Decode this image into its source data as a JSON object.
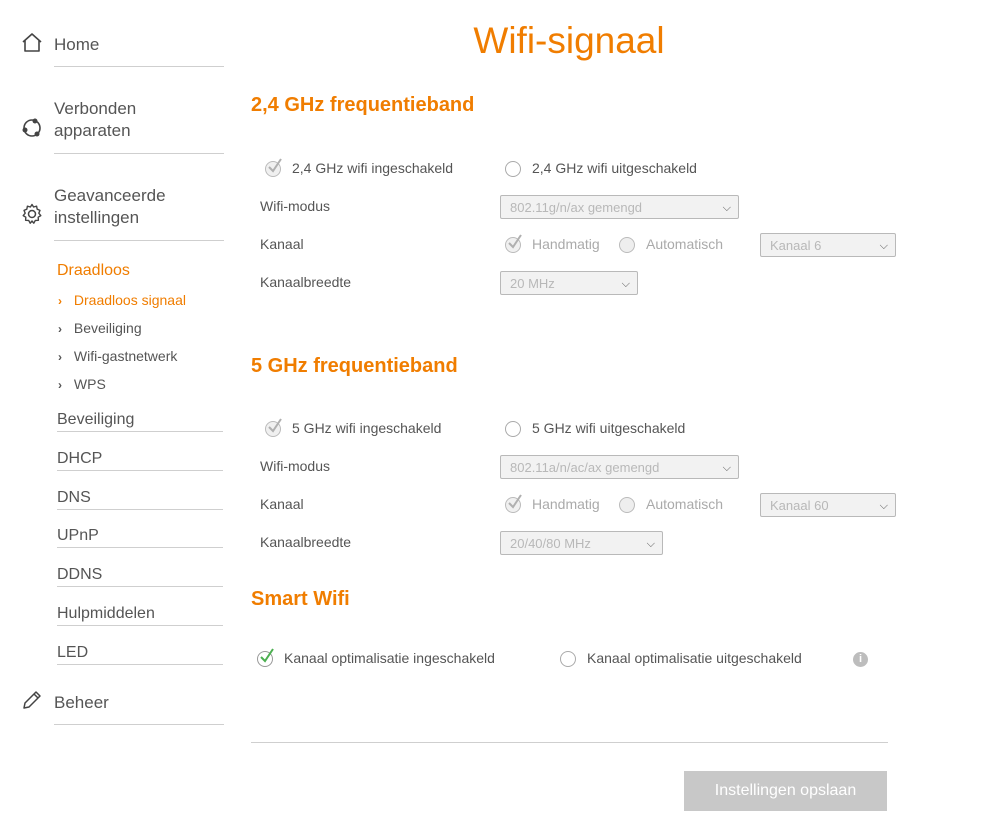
{
  "sidebar": {
    "home": "Home",
    "devices": "Verbonden apparaten",
    "advanced": "Geavanceerde instellingen",
    "wireless": "Draadloos",
    "wireless_sub": [
      "Draadloos signaal",
      "Beveiliging",
      "Wifi-gastnetwerk",
      "WPS"
    ],
    "items": [
      "Beveiliging",
      "DHCP",
      "DNS",
      "UPnP",
      "DDNS",
      "Hulpmiddelen",
      "LED"
    ],
    "manage": "Beheer"
  },
  "page": {
    "title": "Wifi-signaal"
  },
  "band24": {
    "title": "2,4 GHz frequentieband",
    "enabled": "2,4 GHz wifi ingeschakeld",
    "disabled": "2,4 GHz wifi uitgeschakeld",
    "mode_label": "Wifi-modus",
    "mode_value": "802.11g/n/ax gemengd",
    "channel_label": "Kanaal",
    "manual": "Handmatig",
    "automatic": "Automatisch",
    "channel_value": "Kanaal 6",
    "width_label": "Kanaalbreedte",
    "width_value": "20 MHz"
  },
  "band5": {
    "title": "5 GHz frequentieband",
    "enabled": "5 GHz wifi ingeschakeld",
    "disabled": "5 GHz wifi uitgeschakeld",
    "mode_label": "Wifi-modus",
    "mode_value": "802.11a/n/ac/ax gemengd",
    "channel_label": "Kanaal",
    "manual": "Handmatig",
    "automatic": "Automatisch",
    "channel_value": "Kanaal 60",
    "width_label": "Kanaalbreedte",
    "width_value": "20/40/80 MHz"
  },
  "smart": {
    "title": "Smart Wifi",
    "enabled": "Kanaal optimalisatie ingeschakeld",
    "disabled": "Kanaal optimalisatie uitgeschakeld"
  },
  "save_label": "Instellingen opslaan",
  "colors": {
    "accent": "#f07d00",
    "text": "#555555",
    "disabled": "#c8c8c8",
    "check_green": "#4caf50"
  }
}
